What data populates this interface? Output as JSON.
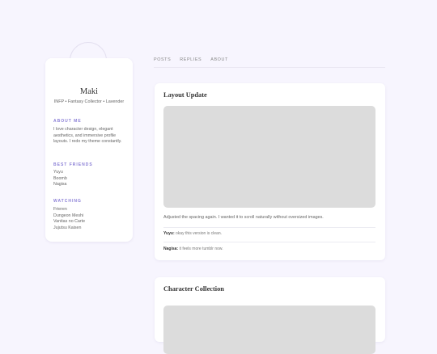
{
  "profile": {
    "name": "Maki",
    "tagline": "INFP • Fantasy Collector • Lavender",
    "about_title": "ABOUT ME",
    "about_text": "I love character design, elegant aesthetics, and immersive profile layouts. I redo my theme constantly.",
    "friends_title": "BEST FRIENDS",
    "friends": [
      "Yuyu",
      "Boomb",
      "Nagisa"
    ],
    "watching_title": "WATCHING",
    "watching": [
      "Frieren",
      "Dungeon Meshi",
      "Vanitas no Carte",
      "Jujutsu Kaisen"
    ]
  },
  "tabs": [
    "POSTS",
    "REPLIES",
    "ABOUT"
  ],
  "posts": [
    {
      "title": "Layout Update",
      "caption": "Adjusted the spacing again. I wanted it to scroll naturally without oversized images.",
      "comments": [
        {
          "author": "Yuyu:",
          "text": "okay this version is clean."
        },
        {
          "author": "Nagisa:",
          "text": "it feels more tumblr now."
        }
      ]
    },
    {
      "title": "Character Collection"
    }
  ],
  "colors": {
    "background": "#f7f5fe",
    "accent": "#8b7fd6",
    "card": "#ffffff",
    "image_placeholder": "#dcdcdc"
  }
}
